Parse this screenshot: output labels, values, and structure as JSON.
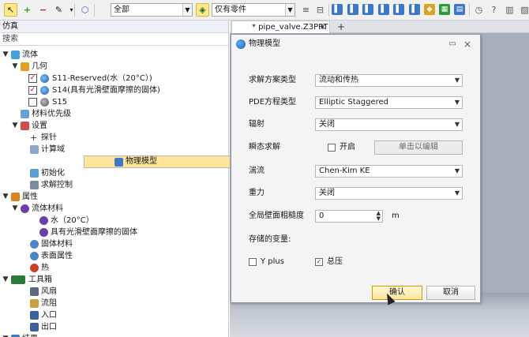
{
  "toolbar": {
    "filter_value": "全部",
    "part_filter_value": "仅有零件"
  },
  "left_panel": {
    "title": "仿真",
    "search_placeholder": "搜索",
    "tree": [
      {
        "label": "流体",
        "expander": "▼"
      },
      {
        "label": "几何",
        "expander": "▼"
      },
      {
        "label": "S11-Reserved(水（20°C）)",
        "checked": true
      },
      {
        "label": "S14(具有光滑壁面摩擦的固体)",
        "checked": true
      },
      {
        "label": "S15",
        "checked": false
      },
      {
        "label": "材料优先级"
      },
      {
        "label": "设置",
        "expander": "▼"
      },
      {
        "label": "探针"
      },
      {
        "label": "计算域"
      },
      {
        "label": "物理模型",
        "selected": true
      },
      {
        "label": "初始化"
      },
      {
        "label": "求解控制"
      },
      {
        "label": "属性",
        "expander": "▼"
      },
      {
        "label": "流体材料",
        "expander": "▼"
      },
      {
        "label": "水（20°C）"
      },
      {
        "label": "具有光滑壁面摩擦的固体"
      },
      {
        "label": "固体材料"
      },
      {
        "label": "表面属性"
      },
      {
        "label": "热"
      },
      {
        "label": "工具箱",
        "expander": "▼"
      },
      {
        "label": "风扇"
      },
      {
        "label": "流阻"
      },
      {
        "label": "入口"
      },
      {
        "label": "出口"
      },
      {
        "label": "结果",
        "expander": "▼"
      }
    ]
  },
  "editor": {
    "tab_label": "* pipe_valve.Z3PRT",
    "tab_close": "×",
    "add_tab": "+"
  },
  "dialog": {
    "title": "物理模型",
    "fields": {
      "solver_type_label": "求解方案类型",
      "solver_type_value": "流动和传热",
      "pde_label": "PDE方程类型",
      "pde_value": "Elliptic Staggered",
      "radiation_label": "辐射",
      "radiation_value": "关闭",
      "transient_label": "瞬态求解",
      "transient_checkbox_label": "开启",
      "transient_edit_button": "单击以编辑",
      "turbulence_label": "湍流",
      "turbulence_value": "Chen-Kim KE",
      "gravity_label": "重力",
      "gravity_value": "关闭",
      "roughness_label": "全局壁面粗糙度",
      "roughness_value": "0",
      "roughness_unit": "m",
      "stored_vars_label": "存储的变量:",
      "yplus_label": "Y plus",
      "yplus_checked": false,
      "total_pressure_label": "总压",
      "total_pressure_checked": true
    },
    "ok_button": "确认",
    "cancel_button": "取消"
  },
  "colors": {
    "selection_row": "#ffe49c",
    "primary_button": "#fce7a0",
    "viewport": "#a7b0ba"
  }
}
